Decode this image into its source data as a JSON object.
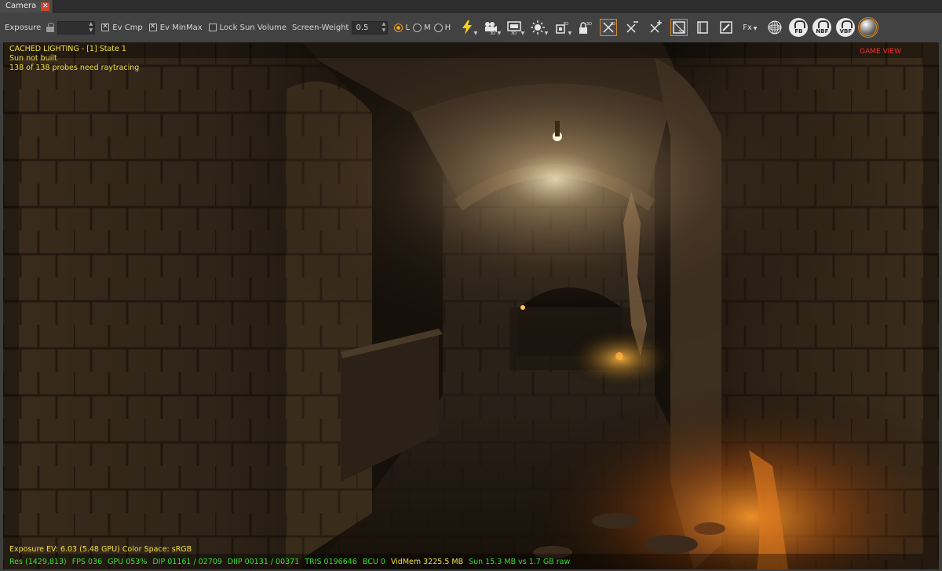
{
  "tab": {
    "title": "Camera",
    "close_glyph": "✕"
  },
  "toolbar": {
    "exposure_label": "Exposure",
    "exposure_value": "",
    "ev_cmp_label": "Ev Cmp",
    "ev_cmp_checked": true,
    "ev_minmax_label": "Ev MinMax",
    "ev_minmax_checked": true,
    "lock_sun_label": "Lock Sun Volume",
    "lock_sun_checked": false,
    "screen_weight_label": "Screen-Weight",
    "screen_weight_value": "0.5",
    "quality_options": [
      {
        "label": "L",
        "selected": true
      },
      {
        "label": "M",
        "selected": false
      },
      {
        "label": "H",
        "selected": false
      }
    ],
    "fx_label": "Fx",
    "badge_fb": "FB",
    "badge_nbf": "NBF",
    "badge_vbf": "VBF",
    "icons": [
      "lightning-icon",
      "camera-3d-icon",
      "render-3d-icon",
      "sun-icon",
      "box-3d-icon",
      "lock-3d-icon",
      "collapse-2d-icon",
      "collapse-x-icon",
      "add-x-icon",
      "view-3d-icon",
      "frame-icon",
      "edit-icon",
      "wireframe-sphere-icon",
      "fb-icon",
      "nbf-icon",
      "vbf-icon",
      "material-sphere-icon"
    ],
    "accent_color": "#d88a2a"
  },
  "viewport": {
    "status_lines": [
      "CACHED LIGHTING - [1] State 1",
      "Sun not built",
      "138 of 138 probes need raytracing"
    ],
    "game_view_label": "GAME VIEW",
    "exposure_info": "Exposure EV: 6.03 (5.48 GPU)   Color Space: sRGB",
    "stats": {
      "res": "Res (1429,813)",
      "fps": "FPS 036",
      "gpu": "GPU 053%",
      "dip": "DIP 01161 / 02709",
      "diip": "DIIP 00131 / 00371",
      "tris": "TRIS 0196646",
      "bcu": "BCU 0",
      "vidmem": "VidMem 3225.5 MB",
      "sun": "Sun 15.3 MB vs 1.7 GB raw"
    }
  }
}
